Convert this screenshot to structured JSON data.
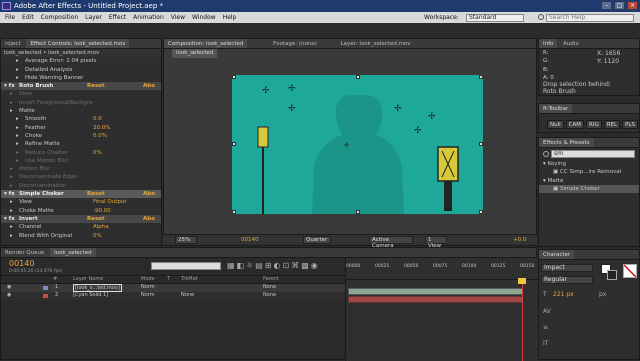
{
  "app": {
    "title": "Adobe After Effects - Untitled Project.aep *"
  },
  "menu": [
    "File",
    "Edit",
    "Composition",
    "Layer",
    "Effect",
    "Animation",
    "View",
    "Window",
    "Help"
  ],
  "workspace": {
    "label": "Workspace:",
    "value": "Standard",
    "search_placeholder": "Search Help"
  },
  "effect_controls": {
    "tabs": [
      "roject",
      "Effect Controls: look_selected.mov"
    ],
    "header": "look_selected • look_selected.mov",
    "rows": [
      {
        "name": "Average Error: 2.04 pixels",
        "value": "",
        "indent": 2,
        "style": "normal"
      },
      {
        "name": "Detailed Analysis",
        "value": "",
        "indent": 2,
        "style": "normal"
      },
      {
        "name": "Hide Warning Banner",
        "value": "",
        "indent": 2,
        "style": "normal"
      },
      {
        "name": "Roto Brush",
        "value": "",
        "indent": 0,
        "style": "section",
        "reset": "Reset",
        "about": "Abo"
      },
      {
        "name": "View",
        "value": "",
        "indent": 1,
        "style": "dim"
      },
      {
        "name": "Invert Foreground/Backgro",
        "value": "",
        "indent": 1,
        "style": "dim"
      },
      {
        "name": "Matte",
        "value": "",
        "indent": 1,
        "style": "normal"
      },
      {
        "name": "Smooth",
        "value": "0.0",
        "indent": 2,
        "style": "normal"
      },
      {
        "name": "Feather",
        "value": "20.0%",
        "indent": 2,
        "style": "normal"
      },
      {
        "name": "Choke",
        "value": "0.0%",
        "indent": 2,
        "style": "normal"
      },
      {
        "name": "Refine Matte",
        "value": "",
        "indent": 2,
        "style": "normal"
      },
      {
        "name": "Reduce Chatter",
        "value": "0%",
        "indent": 2,
        "style": "dim"
      },
      {
        "name": "Use Motion Blur",
        "value": "",
        "indent": 2,
        "style": "dim"
      },
      {
        "name": "Motion Blur",
        "value": "",
        "indent": 1,
        "style": "dim"
      },
      {
        "name": "Decontaminate Edge",
        "value": "",
        "indent": 1,
        "style": "dim"
      },
      {
        "name": "Decontamination",
        "value": "",
        "indent": 1,
        "style": "dim"
      },
      {
        "name": "Simple Choker",
        "value": "",
        "indent": 0,
        "style": "section-hl",
        "reset": "Reset",
        "about": "Abo"
      },
      {
        "name": "View",
        "value": "Final Output",
        "indent": 1,
        "style": "normal"
      },
      {
        "name": "Choke Matte",
        "value": "-90.00",
        "indent": 1,
        "style": "normal"
      },
      {
        "name": "Invert",
        "value": "",
        "indent": 0,
        "style": "section",
        "reset": "Reset",
        "about": "Abo"
      },
      {
        "name": "Channel",
        "value": "Alpha",
        "indent": 1,
        "style": "normal"
      },
      {
        "name": "Blend With Original",
        "value": "0%",
        "indent": 1,
        "style": "normal"
      }
    ]
  },
  "composition": {
    "tabs": [
      "Composition: look_selected",
      "Footage: (none)",
      "Layer: look_selected.mov"
    ],
    "subtab": "look_selected",
    "zoom": "25%",
    "timecode": "00140",
    "resolution": "Quarter",
    "camera": "Active Camera",
    "views": "1 View",
    "exposure": "+0.0"
  },
  "info": {
    "tabs": [
      "Info",
      "Audio"
    ],
    "x": "X: 1656",
    "y": "Y: 1120",
    "r": "R:",
    "g": "G:",
    "b": "B:",
    "a": "A: 0",
    "message": "Drop selection behind:\nRoto Brush"
  },
  "toolbar": {
    "title": "ft-Toolbar",
    "buttons": [
      "Null",
      "CAM",
      "RIG",
      "REL",
      "PLS"
    ]
  },
  "effects_presets": {
    "title": "Effects & Presets",
    "search": "sm",
    "items": [
      {
        "label": "Keying",
        "indent": 0
      },
      {
        "label": "CC Simp...ire Removal",
        "indent": 1
      },
      {
        "label": "Matte",
        "indent": 0
      },
      {
        "label": "Simple Choker",
        "indent": 1
      }
    ]
  },
  "character": {
    "title": "Character",
    "font": "Impact",
    "style": "Regular",
    "size": "221 px",
    "tracking": "px"
  },
  "timeline": {
    "tabs": [
      "Render Queue",
      "look_selected"
    ],
    "timecode": "00140",
    "fps": "0:00:05:20 (23.976 fps)",
    "search_placeholder": "",
    "columns": [
      "#",
      "Layer Name",
      "Mode",
      "T",
      "TrkMat",
      "Parent"
    ],
    "layers": [
      {
        "num": "1",
        "name": "[look_s...ted.mov]",
        "mode": "Norm",
        "trkmat": "",
        "parent": "None",
        "color": "#7a8fbf"
      },
      {
        "num": "2",
        "name": "[Cyan Solid 1]",
        "mode": "Norm",
        "trkmat": "None",
        "parent": "None",
        "color": "#c84a4a"
      }
    ],
    "ruler": [
      "00000",
      "00025",
      "00050",
      "00075",
      "00100",
      "00125",
      "00150"
    ]
  }
}
